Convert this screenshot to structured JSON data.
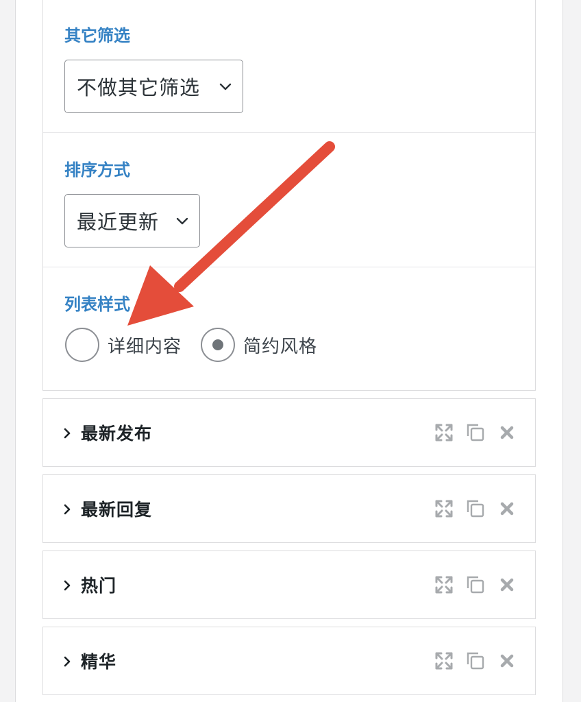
{
  "widget_form": {
    "other_filter": {
      "label": "其它筛选",
      "selected": "不做其它筛选"
    },
    "sort": {
      "label": "排序方式",
      "selected": "最近更新"
    },
    "list_style": {
      "label": "列表样式",
      "options": [
        {
          "label": "详细内容",
          "checked": false
        },
        {
          "label": "简约风格",
          "checked": true
        }
      ]
    }
  },
  "widgets": [
    {
      "title": "最新发布"
    },
    {
      "title": "最新回复"
    },
    {
      "title": "热门"
    },
    {
      "title": "精华"
    }
  ],
  "icons": {
    "expand": "fullscreen-icon",
    "duplicate": "copy-icon",
    "remove": "close-icon",
    "caret": "chevron-right-icon",
    "select": "chevron-down-icon"
  },
  "colors": {
    "label_blue": "#3582c4",
    "annotation_arrow": "#e44d3a",
    "icon_gray": "#a7aaad",
    "border": "#dcdcde"
  }
}
